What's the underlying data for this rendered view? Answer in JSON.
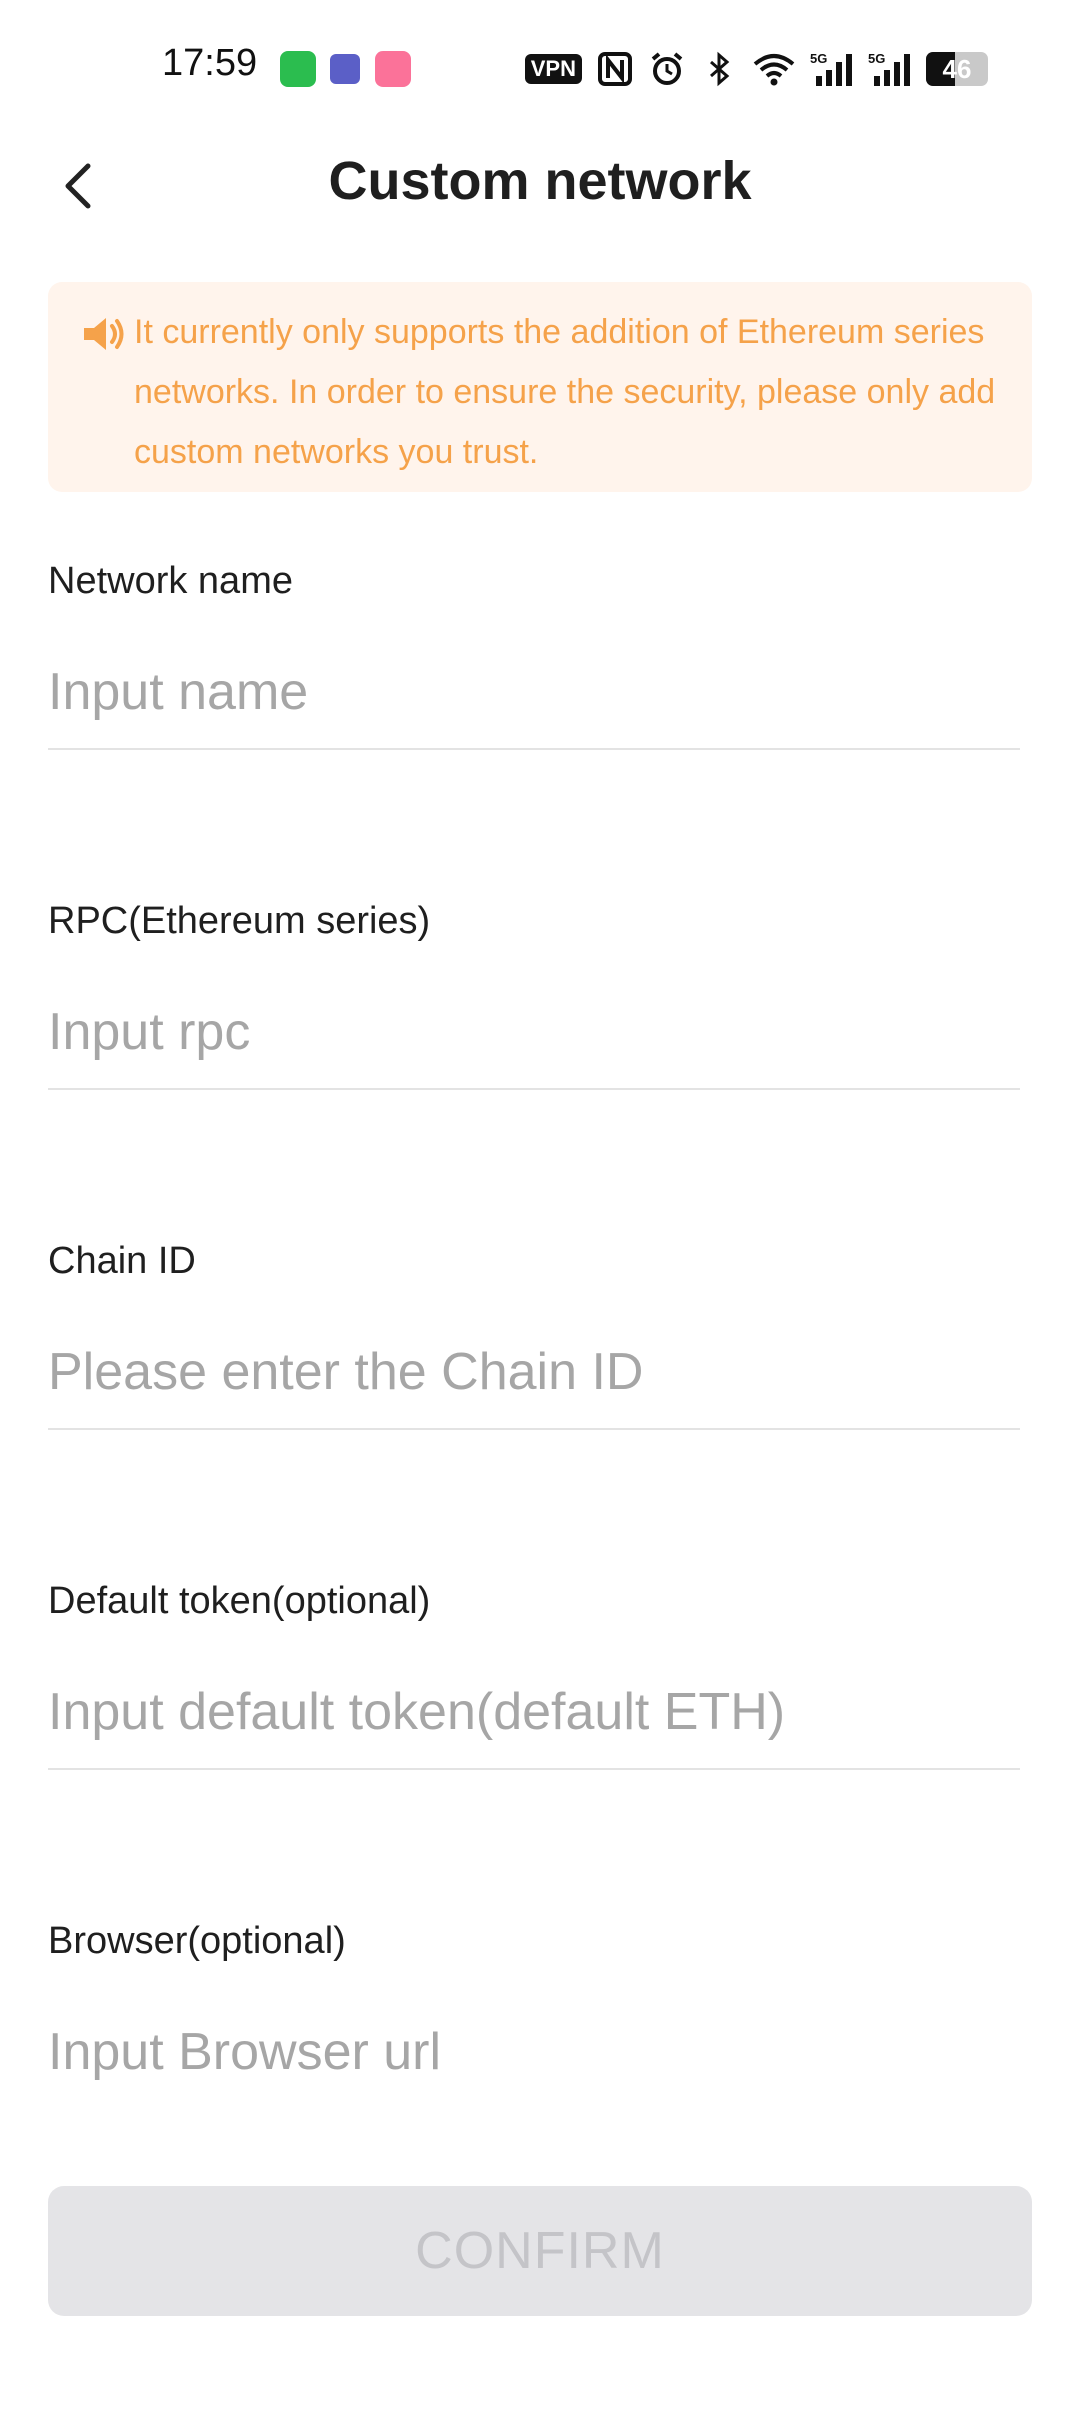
{
  "status_bar": {
    "time": "17:59",
    "vpn_label": "VPN",
    "battery_level": "46",
    "signal_1_label": "5G",
    "signal_2_label": "5G",
    "icons": [
      "app-icon-1",
      "teams-icon",
      "bilibili-icon",
      "vpn-icon",
      "nfc-icon",
      "alarm-icon",
      "bluetooth-icon",
      "wifi-icon",
      "signal-icon",
      "signal-icon",
      "battery-icon"
    ]
  },
  "header": {
    "title": "Custom network",
    "back_icon": "chevron-left-icon"
  },
  "notice": {
    "icon": "speaker-icon",
    "text": "It currently only supports the addition of Ethereum series networks. In order to ensure the security, please only add custom networks you trust.",
    "color": "#f5a24a",
    "background": "#fff4ec"
  },
  "form": {
    "network_name": {
      "label": "Network name",
      "placeholder": "Input name",
      "value": ""
    },
    "rpc": {
      "label": "RPC(Ethereum series)",
      "placeholder": "Input rpc",
      "value": ""
    },
    "chain_id": {
      "label": "Chain ID",
      "placeholder": "Please enter the Chain ID",
      "value": ""
    },
    "default_token": {
      "label": "Default token(optional)",
      "placeholder": "Input default token(default ETH)",
      "value": ""
    },
    "browser": {
      "label": "Browser(optional)",
      "placeholder": "Input Browser url",
      "value": ""
    }
  },
  "confirm": {
    "label": "CONFIRM",
    "disabled": true
  }
}
